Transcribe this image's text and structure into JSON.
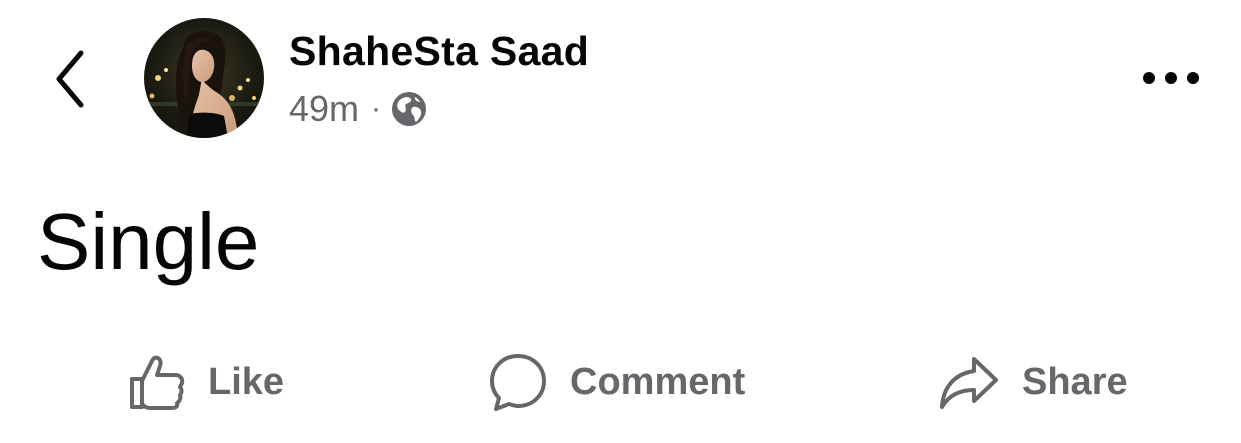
{
  "post": {
    "author_name": "ShaheSta Saad",
    "timestamp": "49m",
    "separator": "·",
    "audience_icon": "globe-icon",
    "text": "Single"
  },
  "navigation": {
    "back_icon": "chevron-left-icon",
    "more_icon": "ellipsis-icon"
  },
  "actions": [
    {
      "label": "Like",
      "icon": "thumbs-up-icon"
    },
    {
      "label": "Comment",
      "icon": "comment-bubble-icon"
    },
    {
      "label": "Share",
      "icon": "share-arrow-icon"
    }
  ],
  "colors": {
    "text_primary": "#050505",
    "text_secondary": "#65676b",
    "background": "#ffffff"
  }
}
